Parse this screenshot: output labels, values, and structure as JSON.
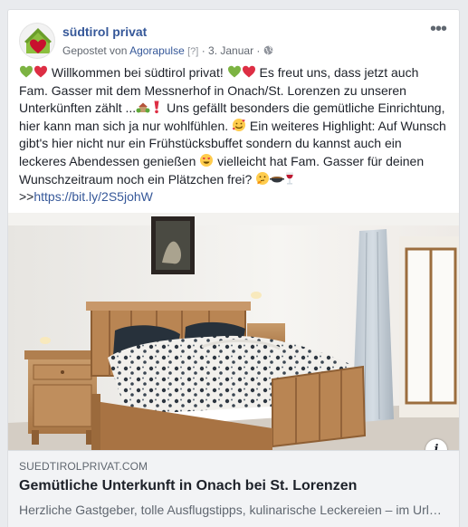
{
  "post": {
    "page_name": "südtirol privat",
    "posted_prefix": "Gepostet von ",
    "posted_by": "Agorapulse",
    "help_marker": "[?]",
    "separator": " · ",
    "date": "3. Januar",
    "privacy_icon": "globe-icon",
    "more_icon": "ellipsis-icon"
  },
  "text": {
    "p1": " Willkommen bei südtirol privat! ",
    "p2": " Es freut uns, dass jetzt auch Fam. Gasser mit dem Messnerhof in Onach/St. Lorenzen zu unseren Unterkünften zählt ...",
    "p3": " Uns gefällt besonders die gemütliche Einrichtung, hier kann man sich ja nur wohlfühlen. ",
    "p4": " Ein weiteres Highlight: Auf Wunsch gibt's hier nicht nur ein Frühstücksbuffet sondern du kannst auch ein leckeres Abendessen genießen ",
    "p5": " vielleicht hat Fam. Gasser für deinen Wunschzeitraum noch ein Plätzchen frei? ",
    "link_prefix": ">>",
    "link": "https://bit.ly/2S5johW"
  },
  "link_preview": {
    "domain": "SUEDTIROLPRIVAT.COM",
    "title": "Gemütliche Unterkunft in Onach bei St. Lorenzen",
    "description": "Herzliche Gastgeber, tolle Ausflugstipps, kulinarische Leckereien – im Urlaub in Südtirol",
    "info_label": "i",
    "info_icon": "info-icon"
  },
  "colors": {
    "link": "#365899",
    "text": "#1d2129",
    "muted": "#616770",
    "green_heart": "#7cb342",
    "red_heart": "#dd2e44"
  }
}
